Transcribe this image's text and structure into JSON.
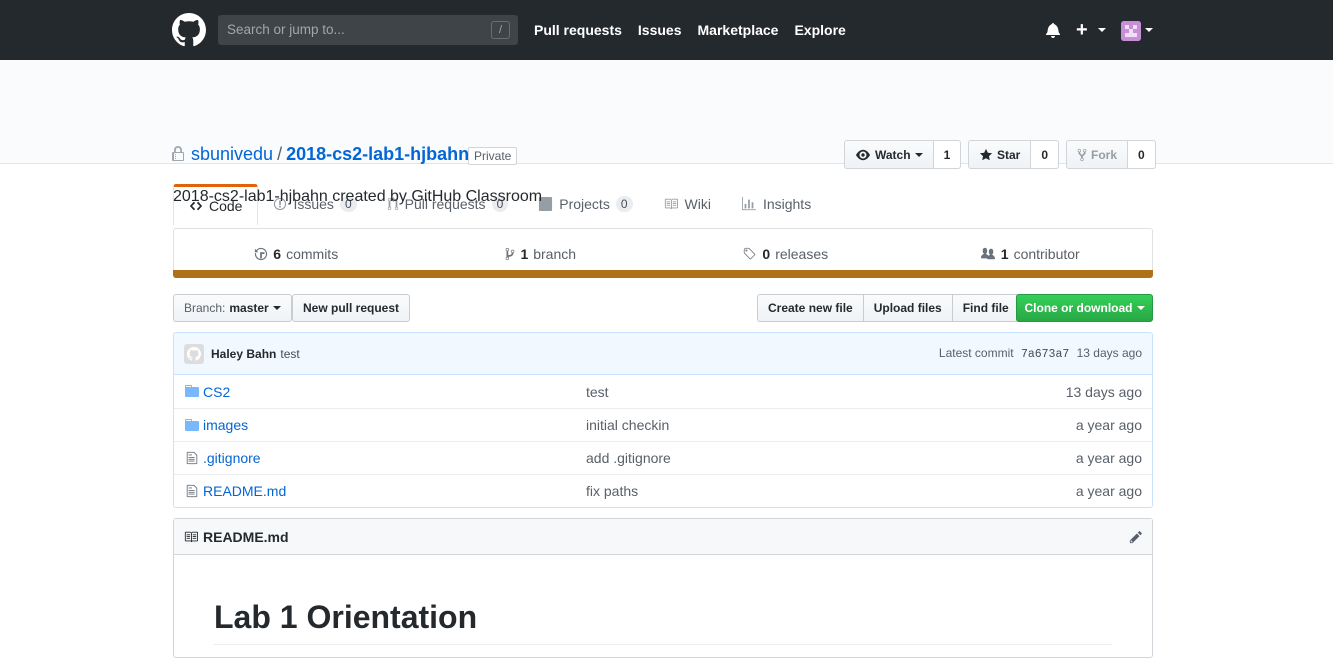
{
  "header": {
    "search_placeholder": "Search or jump to...",
    "search_hotkey": "/",
    "nav": [
      "Pull requests",
      "Issues",
      "Marketplace",
      "Explore"
    ]
  },
  "repo": {
    "owner": "sbunivedu",
    "separator": "/",
    "name": "2018-cs2-lab1-hjbahn",
    "visibility": "Private",
    "watch_label": "Watch",
    "watch_count": "1",
    "star_label": "Star",
    "star_count": "0",
    "fork_label": "Fork",
    "fork_count": "0"
  },
  "tabs": [
    {
      "label": "Code"
    },
    {
      "label": "Issues",
      "count": "0"
    },
    {
      "label": "Pull requests",
      "count": "0"
    },
    {
      "label": "Projects",
      "count": "0"
    },
    {
      "label": "Wiki"
    },
    {
      "label": "Insights"
    }
  ],
  "description": "2018-cs2-lab1-hjbahn created by GitHub Classroom",
  "summary": {
    "commits_count": "6",
    "commits_label": "commits",
    "branch_count": "1",
    "branch_label": "branch",
    "releases_count": "0",
    "releases_label": "releases",
    "contributor_count": "1",
    "contributor_label": "contributor"
  },
  "language_color": "#b07219",
  "toolbar": {
    "branch_prefix": "Branch:",
    "branch_name": "master",
    "new_pr": "New pull request",
    "create_file": "Create new file",
    "upload_files": "Upload files",
    "find_file": "Find file",
    "clone": "Clone or download"
  },
  "latest_commit": {
    "author": "Haley Bahn",
    "message": "test",
    "prefix": "Latest commit",
    "sha": "7a673a7",
    "age": "13 days ago"
  },
  "files": [
    {
      "type": "dir",
      "name": "CS2",
      "message": "test",
      "age": "13 days ago"
    },
    {
      "type": "dir",
      "name": "images",
      "message": "initial checkin",
      "age": "a year ago"
    },
    {
      "type": "file",
      "name": ".gitignore",
      "message": "add .gitignore",
      "age": "a year ago"
    },
    {
      "type": "file",
      "name": "README.md",
      "message": "fix paths",
      "age": "a year ago"
    }
  ],
  "readme": {
    "filename": "README.md",
    "heading": "Lab 1 Orientation"
  }
}
